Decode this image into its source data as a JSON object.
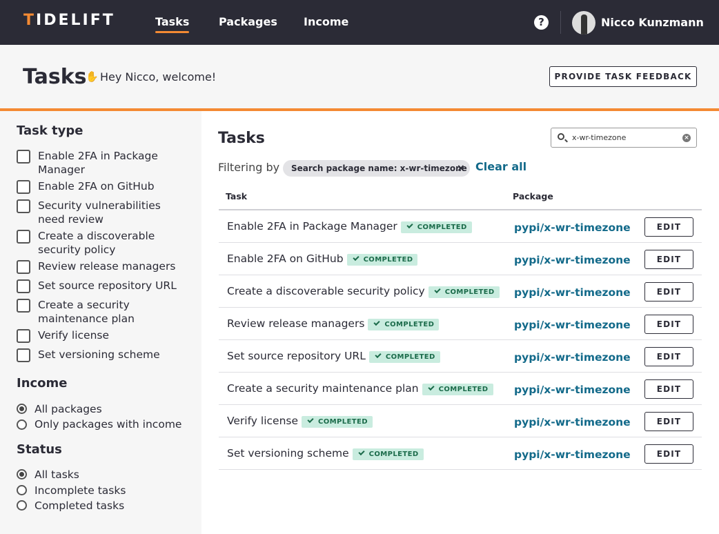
{
  "nav": {
    "logo_a": "T",
    "logo_b": "IDELIFT",
    "links": [
      "Tasks",
      "Packages",
      "Income"
    ],
    "help": "?",
    "user_name": "Nicco Kunzmann"
  },
  "header": {
    "title": "Tasks",
    "welcome": "Hey Nicco, welcome!",
    "feedback_button": "PROVIDE TASK FEEDBACK"
  },
  "sidebar": {
    "task_type_heading": "Task type",
    "task_types": [
      "Enable 2FA in Package Manager",
      "Enable 2FA on GitHub",
      "Security vulnerabilities need review",
      "Create a discoverable security policy",
      "Review release managers",
      "Set source repository URL",
      "Create a security maintenance plan",
      "Verify license",
      "Set versioning scheme"
    ],
    "income_heading": "Income",
    "income_options": [
      "All packages",
      "Only packages with income"
    ],
    "status_heading": "Status",
    "status_options": [
      "All tasks",
      "Incomplete tasks",
      "Completed tasks"
    ]
  },
  "main": {
    "title": "Tasks",
    "search_value": "x-wr-timezone",
    "filtering_by": "Filtering by",
    "filter_chip": "Search package name: x-wr-timezone",
    "clear_all": "Clear all",
    "columns": [
      "Task",
      "Package"
    ],
    "badge_label": "COMPLETED",
    "edit_label": "EDIT",
    "rows": [
      {
        "task": "Enable 2FA in Package Manager",
        "package": "pypi/x-wr-timezone"
      },
      {
        "task": "Enable 2FA on GitHub",
        "package": "pypi/x-wr-timezone"
      },
      {
        "task": "Create a discoverable security policy",
        "package": "pypi/x-wr-timezone"
      },
      {
        "task": "Review release managers",
        "package": "pypi/x-wr-timezone"
      },
      {
        "task": "Set source repository URL",
        "package": "pypi/x-wr-timezone"
      },
      {
        "task": "Create a security maintenance plan",
        "package": "pypi/x-wr-timezone"
      },
      {
        "task": "Verify license",
        "package": "pypi/x-wr-timezone"
      },
      {
        "task": "Set versioning scheme",
        "package": "pypi/x-wr-timezone"
      }
    ]
  },
  "colors": {
    "accent": "#f48a33",
    "nav_bg": "#2b2b36",
    "link": "#136a8a",
    "badge_bg": "#c9ecdf"
  }
}
